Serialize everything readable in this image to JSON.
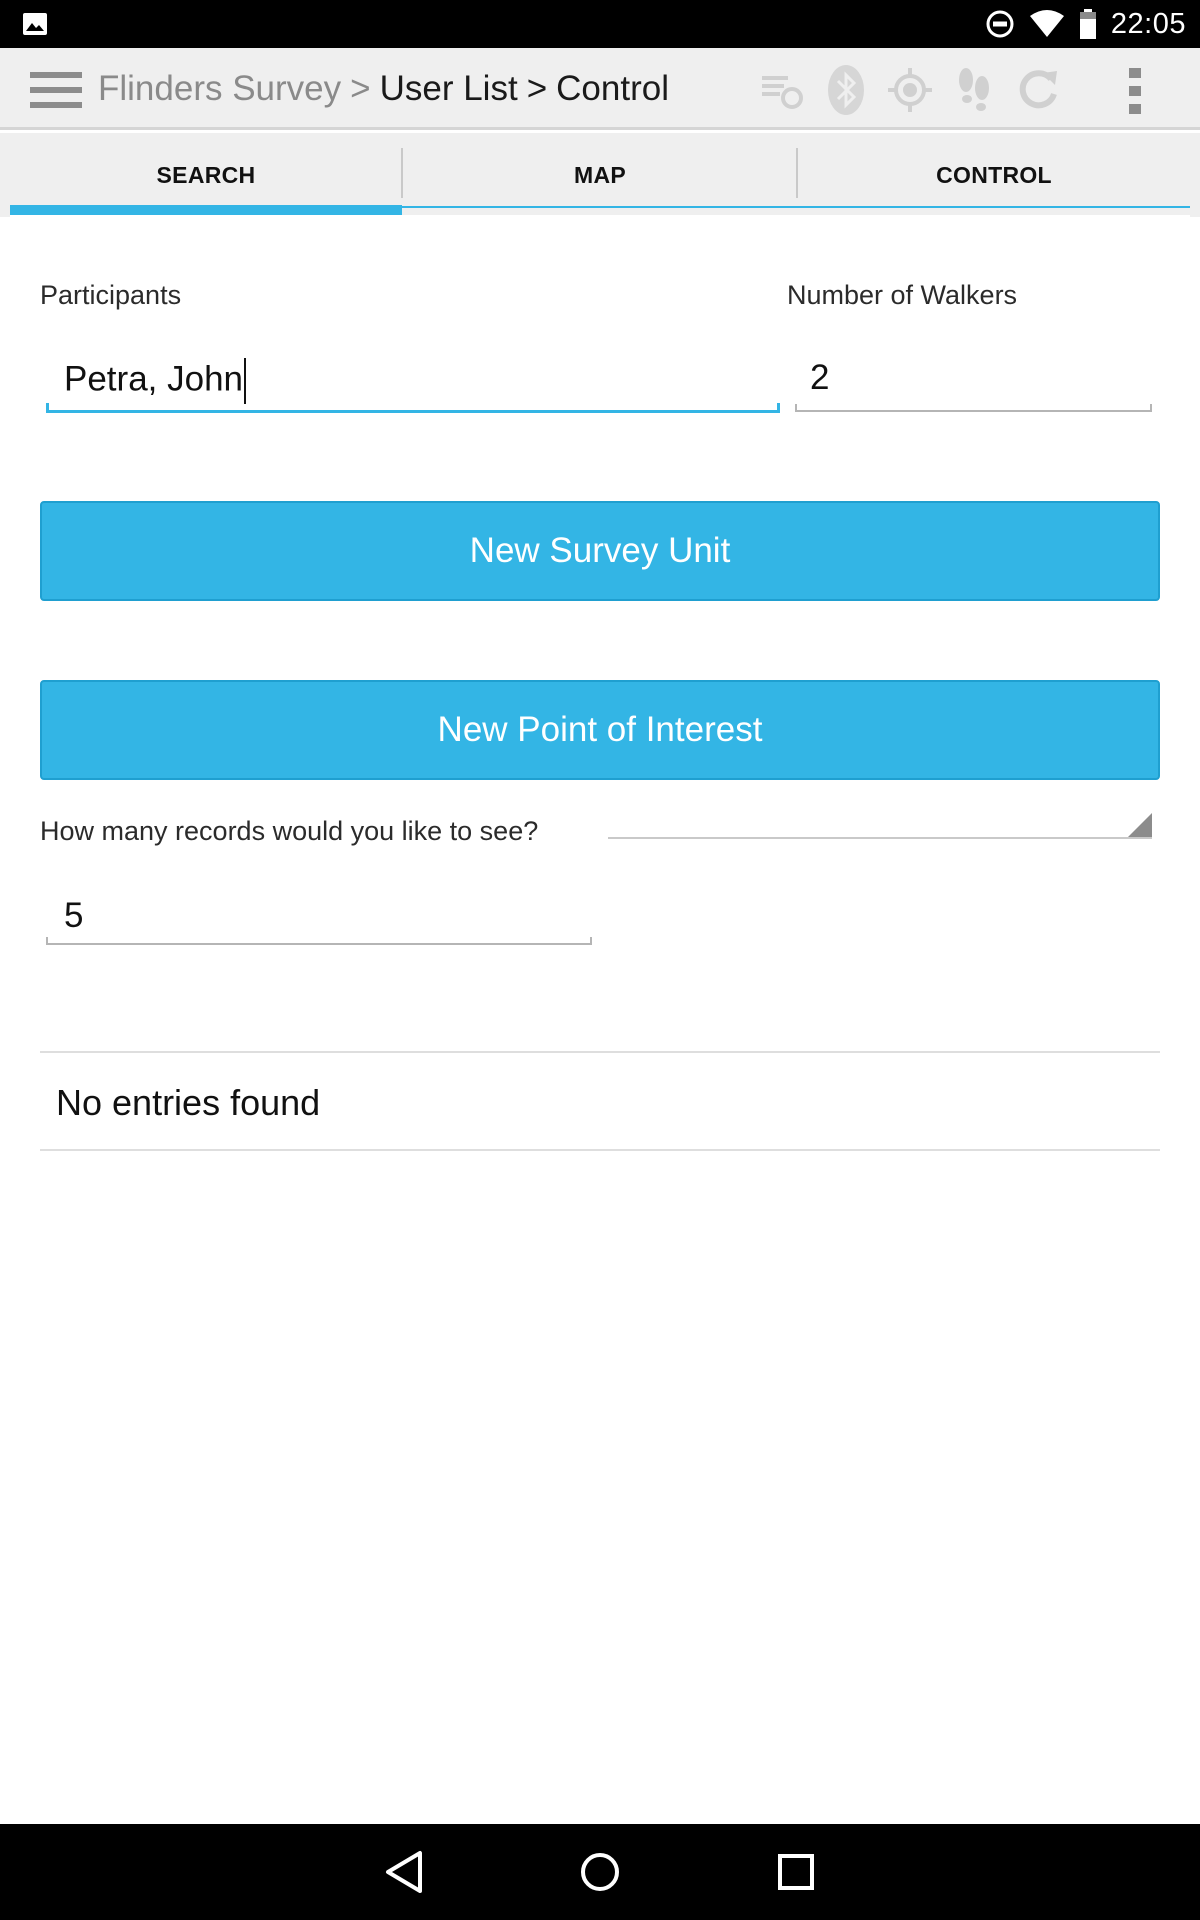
{
  "status_bar": {
    "time": "22:05",
    "icons": [
      "picture-icon",
      "do-not-disturb-icon",
      "wifi-icon",
      "battery-icon"
    ]
  },
  "action_bar": {
    "breadcrumb": {
      "app": "Flinders Survey",
      "separator": ">",
      "level2": "User List",
      "current": "Control"
    },
    "icons": [
      "sync-list-icon",
      "bluetooth-icon",
      "gps-target-icon",
      "footsteps-icon",
      "refresh-icon",
      "overflow-menu-icon"
    ]
  },
  "tabs": [
    {
      "label": "SEARCH",
      "active": true
    },
    {
      "label": "MAP",
      "active": false
    },
    {
      "label": "CONTROL",
      "active": false
    }
  ],
  "form": {
    "participants": {
      "label": "Participants",
      "value": "Petra, John"
    },
    "walkers": {
      "label": "Number of Walkers",
      "value": "2"
    },
    "new_survey_unit_label": "New Survey Unit",
    "new_poi_label": "New Point of Interest",
    "records": {
      "label": "How many records would you like to see?",
      "value": "5"
    }
  },
  "list": {
    "empty_text": "No entries found"
  },
  "nav_bar": {
    "icons": [
      "back-icon",
      "home-icon",
      "recents-icon"
    ]
  },
  "colors": {
    "accent": "#33b5e5",
    "status_bar": "#000000",
    "action_bar": "#efefef"
  }
}
